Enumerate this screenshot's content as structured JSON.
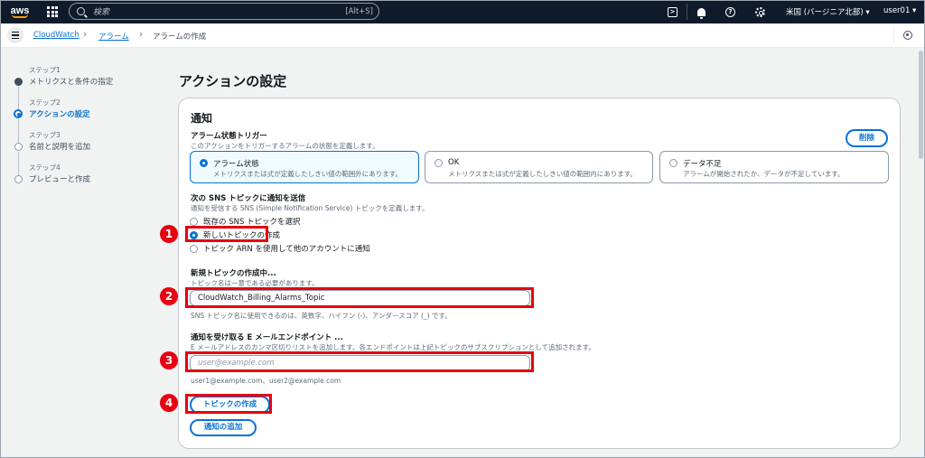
{
  "topnav": {
    "search_placeholder": "検索",
    "search_shortcut": "[Alt+S]",
    "region": "米国 (バージニア北部) ▾",
    "user": "user01 ▾"
  },
  "breadcrumb": {
    "items": [
      "CloudWatch",
      "アラーム",
      "アラームの作成"
    ]
  },
  "steps": [
    {
      "num": "ステップ1",
      "label": "メトリクスと条件の指定",
      "state": "done"
    },
    {
      "num": "ステップ2",
      "label": "アクションの設定",
      "state": "active"
    },
    {
      "num": "ステップ3",
      "label": "名前と説明を追加",
      "state": "todo"
    },
    {
      "num": "ステップ4",
      "label": "プレビューと作成",
      "state": "todo"
    }
  ],
  "main": {
    "page_title": "アクションの設定",
    "section_title": "通知",
    "trigger_label": "アラーム状態トリガー",
    "trigger_desc": "このアクションをトリガーするアラームの状態を定義します。",
    "delete_label": "削除",
    "tiles": [
      {
        "title": "アラーム状態",
        "desc": "メトリクスまたは式が定義したしきい値の範囲外にあります。",
        "selected": true
      },
      {
        "title": "OK",
        "desc": "メトリクスまたは式が定義したしきい値の範囲内にあります。",
        "selected": false
      },
      {
        "title": "データ不足",
        "desc": "アラームが開始されたか、データが不足しています。",
        "selected": false
      }
    ],
    "sns_label": "次の SNS トピックに通知を送信",
    "sns_desc": "通知を受信する SNS (Simple Notification Service) トピックを定義します。",
    "sns_options": [
      {
        "label": "既存の SNS トピックを選択",
        "selected": false
      },
      {
        "label": "新しいトピックの作成",
        "selected": true
      },
      {
        "label": "トピック ARN を使用して他のアカウントに通知",
        "selected": false
      }
    ],
    "new_topic_label": "新規トピックの作成中...",
    "new_topic_desc": "トピック名は一意である必要があります。",
    "topic_name_value": "CloudWatch_Billing_Alarms_Topic",
    "topic_name_hint": "SNS トピック名に使用できるのは、英数字、ハイフン (-)、アンダースコア (_) です。",
    "endpoint_label": "通知を受け取る E メールエンドポイント ...",
    "endpoint_desc": "E メールアドレスのカンマ区切りリストを追加します。各エンドポイントは上記トピックのサブスクリプションとして追加されます。",
    "endpoint_placeholder": "user@example.com",
    "endpoint_hint": "user1@example.com、user2@example.com",
    "create_topic_label": "トピックの作成",
    "add_notification_label": "通知の追加"
  },
  "annotations": [
    "1",
    "2",
    "3",
    "4"
  ],
  "colors": {
    "accent": "#0972d3",
    "annotation_red": "#e60012",
    "nav_bg": "#0f1b2a"
  }
}
